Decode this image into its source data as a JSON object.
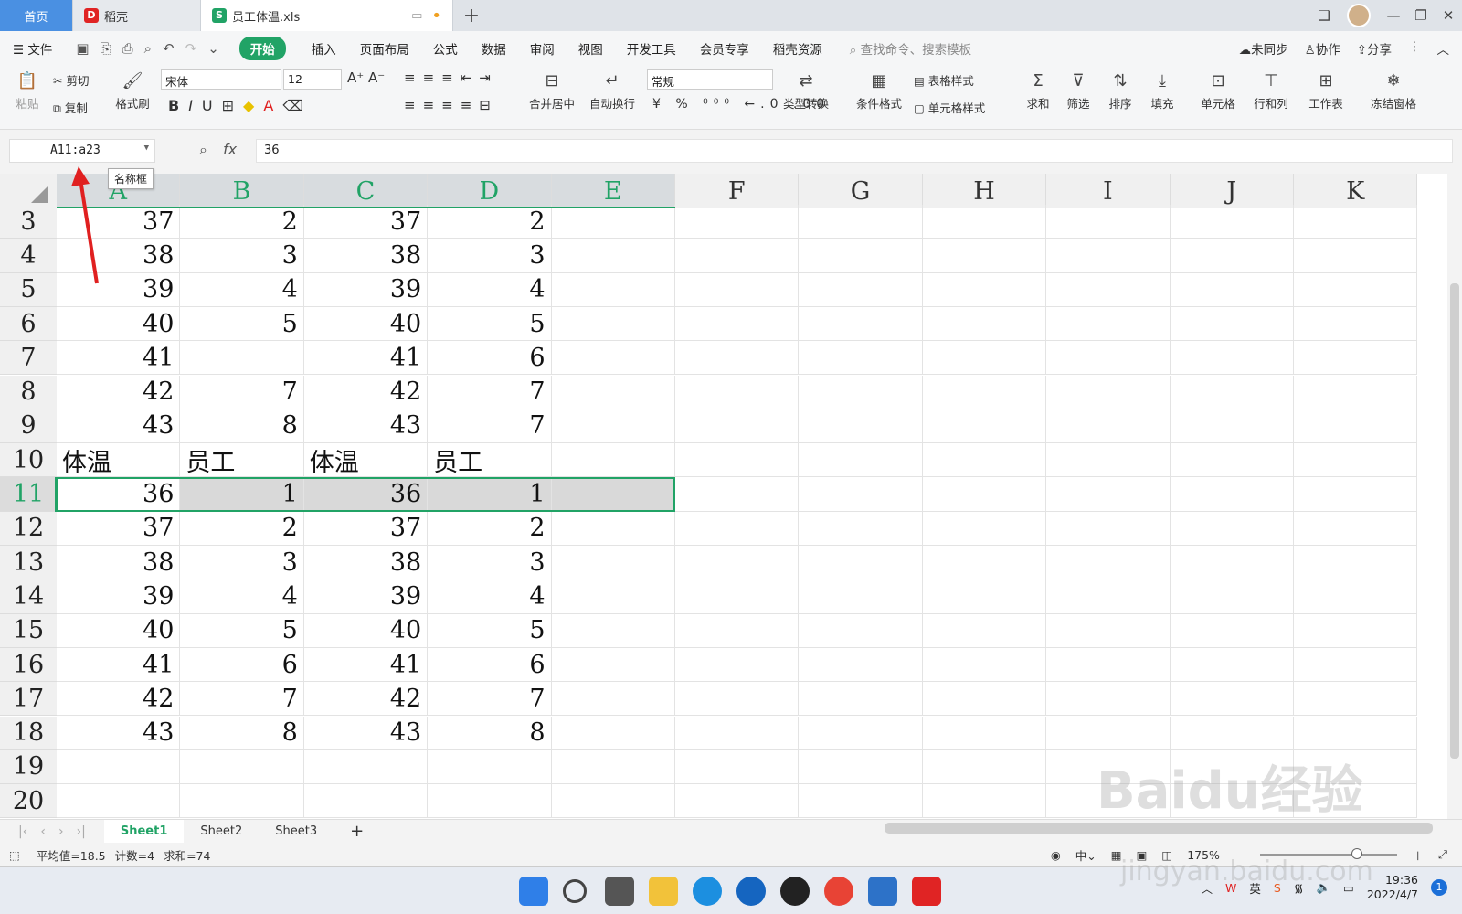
{
  "tabs": {
    "home": "首页",
    "daoke": "稻壳",
    "file": "员工体温.xls",
    "add": "+"
  },
  "menubar": {
    "file": "文件",
    "start": "开始",
    "items": [
      "插入",
      "页面布局",
      "公式",
      "数据",
      "审阅",
      "视图",
      "开发工具",
      "会员专享",
      "稻壳资源"
    ],
    "search": "查找命令、搜索模板",
    "sync": "未同步",
    "collab": "协作",
    "share": "分享"
  },
  "ribbon": {
    "paste": "粘贴",
    "cut": "剪切",
    "copy": "复制",
    "format_painter": "格式刷",
    "font": "宋体",
    "size": "12",
    "merge": "合并居中",
    "wrap": "自动换行",
    "number_format": "常规",
    "type_convert": "类型转换",
    "cond_format": "条件格式",
    "table_style": "表格样式",
    "cell_style": "单元格样式",
    "sum": "求和",
    "filter": "筛选",
    "sort": "排序",
    "fill": "填充",
    "cell": "单元格",
    "rowcol": "行和列",
    "sheet": "工作表",
    "freeze": "冻结窗格"
  },
  "formula": {
    "namebox": "A11:a23",
    "tooltip": "名称框",
    "fx": "fx",
    "value": "36"
  },
  "columns": [
    "A",
    "B",
    "C",
    "D",
    "E",
    "F",
    "G",
    "H",
    "I",
    "J",
    "K"
  ],
  "rows": [
    {
      "n": "3",
      "cells": [
        "37",
        "2",
        "37",
        "2",
        ""
      ]
    },
    {
      "n": "4",
      "cells": [
        "38",
        "3",
        "38",
        "3",
        ""
      ]
    },
    {
      "n": "5",
      "cells": [
        "39",
        "4",
        "39",
        "4",
        ""
      ]
    },
    {
      "n": "6",
      "cells": [
        "40",
        "5",
        "40",
        "5",
        ""
      ]
    },
    {
      "n": "7",
      "cells": [
        "41",
        "",
        "41",
        "6",
        ""
      ]
    },
    {
      "n": "8",
      "cells": [
        "42",
        "7",
        "42",
        "7",
        ""
      ]
    },
    {
      "n": "9",
      "cells": [
        "43",
        "8",
        "43",
        "7",
        ""
      ]
    },
    {
      "n": "10",
      "cells": [
        "体温",
        "员工",
        "体温",
        "员工",
        ""
      ]
    },
    {
      "n": "11",
      "cells": [
        "36",
        "1",
        "36",
        "1",
        ""
      ]
    },
    {
      "n": "12",
      "cells": [
        "37",
        "2",
        "37",
        "2",
        ""
      ]
    },
    {
      "n": "13",
      "cells": [
        "38",
        "3",
        "38",
        "3",
        ""
      ]
    },
    {
      "n": "14",
      "cells": [
        "39",
        "4",
        "39",
        "4",
        ""
      ]
    },
    {
      "n": "15",
      "cells": [
        "40",
        "5",
        "40",
        "5",
        ""
      ]
    },
    {
      "n": "16",
      "cells": [
        "41",
        "6",
        "41",
        "6",
        ""
      ]
    },
    {
      "n": "17",
      "cells": [
        "42",
        "7",
        "42",
        "7",
        ""
      ]
    },
    {
      "n": "18",
      "cells": [
        "43",
        "8",
        "43",
        "8",
        ""
      ]
    },
    {
      "n": "19",
      "cells": [
        "",
        "",
        "",
        "",
        ""
      ]
    },
    {
      "n": "20",
      "cells": [
        "",
        "",
        "",
        "",
        ""
      ]
    }
  ],
  "sheets": [
    "Sheet1",
    "Sheet2",
    "Sheet3"
  ],
  "status": {
    "avg": "平均值=18.5",
    "count": "计数=4",
    "sum": "求和=74",
    "zoom": "175%"
  },
  "taskbar": {
    "lang": "英",
    "time": "19:36",
    "date": "2022/4/7",
    "badge": "1"
  },
  "watermark": {
    "brand": "Baidu经验",
    "url": "jingyan.baidu.com"
  },
  "colors": {
    "accent": "#21a366",
    "selection": "#d9d9d9",
    "arrow": "#e02020"
  }
}
